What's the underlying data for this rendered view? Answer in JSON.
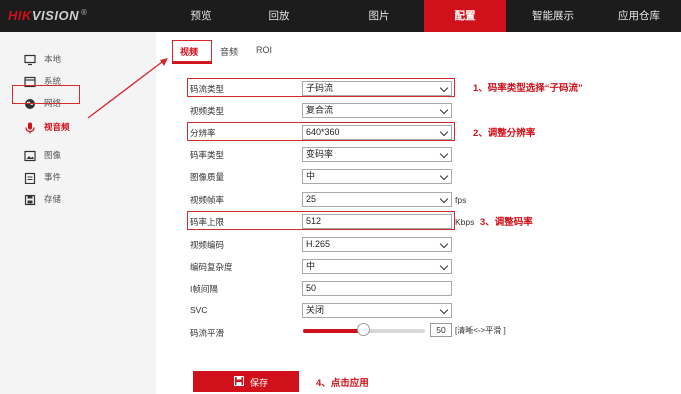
{
  "logo": {
    "brand_main": "HIK",
    "brand_sub": "VISION",
    "reg": "®"
  },
  "nav": {
    "items": [
      {
        "label": "预览",
        "active": false
      },
      {
        "label": "回放",
        "active": false
      },
      {
        "label": "图片",
        "active": false
      },
      {
        "label": "配置",
        "active": true
      },
      {
        "label": "智能展示",
        "active": false
      },
      {
        "label": "应用仓库",
        "active": false
      }
    ]
  },
  "sidebar": {
    "items": [
      {
        "label": "本地",
        "icon": "monitor-icon"
      },
      {
        "label": "系统",
        "icon": "system-window-icon"
      },
      {
        "label": "网络",
        "icon": "globe-icon"
      },
      {
        "label": "视音频",
        "icon": "microphone-icon",
        "active": true
      },
      {
        "label": "图像",
        "icon": "image-icon"
      },
      {
        "label": "事件",
        "icon": "event-calendar-icon"
      },
      {
        "label": "存储",
        "icon": "disk-icon"
      }
    ]
  },
  "tabs": [
    {
      "label": "视频",
      "active": true
    },
    {
      "label": "音频"
    },
    {
      "label": "ROI"
    }
  ],
  "form": {
    "stream_type": {
      "label": "码流类型",
      "value": "子码流"
    },
    "video_type": {
      "label": "视频类型",
      "value": "复合流"
    },
    "resolution": {
      "label": "分辨率",
      "value": "640*360"
    },
    "bitrate_type": {
      "label": "码率类型",
      "value": "变码率"
    },
    "image_quality": {
      "label": "图像质量",
      "value": "中"
    },
    "frame_rate": {
      "label": "视频帧率",
      "value": "25",
      "unit": "fps"
    },
    "max_bitrate": {
      "label": "码率上限",
      "value": "512",
      "unit": "Kbps"
    },
    "video_encoding": {
      "label": "视频编码",
      "value": "H.265"
    },
    "encoding_complexity": {
      "label": "编码复杂度",
      "value": "中"
    },
    "i_frame_interval": {
      "label": "I帧间隔",
      "value": "50"
    },
    "svc": {
      "label": "SVC",
      "value": "关闭"
    },
    "smoothing": {
      "label": "码流平滑",
      "value": "50",
      "fraction": 0.5,
      "hint": "[清晰<->平滑 ]"
    }
  },
  "annotations": {
    "note1": "1、码率类型选择“子码流”",
    "note2": "2、调整分辨率",
    "note3": "3、调整码率",
    "note4": "4、点击应用"
  },
  "save": {
    "label": "保存"
  },
  "colors": {
    "accent": "#d0111b",
    "annotation": "#d32b2b",
    "topbar": "#1c1c1c",
    "sidebar": "#f4f4f4"
  }
}
